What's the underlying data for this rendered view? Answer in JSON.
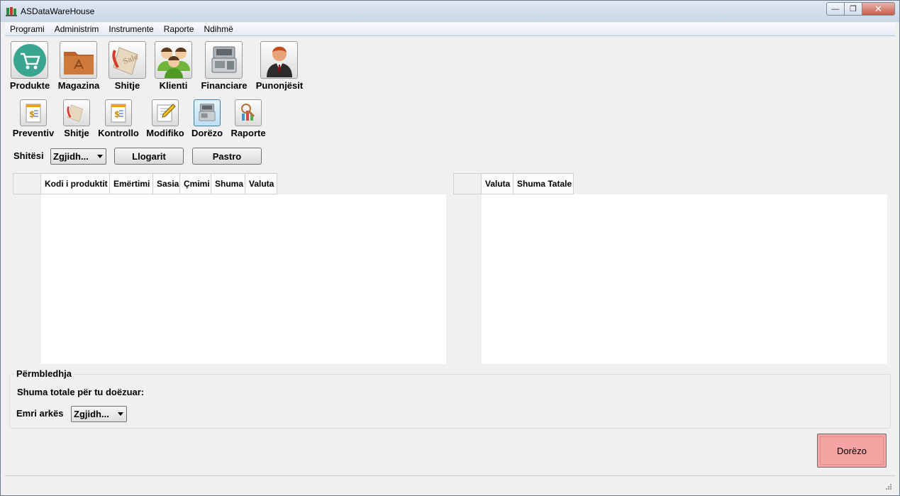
{
  "window": {
    "title": "ASDataWareHouse",
    "minimize": "—",
    "maximize": "❐",
    "close": "✕"
  },
  "menu": [
    "Programi",
    "Administrim",
    "Instrumente",
    "Raporte",
    "Ndihmë"
  ],
  "toolbar_large": [
    {
      "label": "Produkte",
      "icon": "shopping-cart-icon"
    },
    {
      "label": "Magazina",
      "icon": "warehouse-folder-icon"
    },
    {
      "label": "Shitje",
      "icon": "sale-tag-icon"
    },
    {
      "label": "Klienti",
      "icon": "clients-group-icon"
    },
    {
      "label": "Financiare",
      "icon": "cash-register-icon"
    },
    {
      "label": "Punonjësit",
      "icon": "employee-icon"
    }
  ],
  "toolbar_small": [
    {
      "label": "Preventiv",
      "icon": "document-money-icon"
    },
    {
      "label": "Shitje",
      "icon": "sale-tag-icon"
    },
    {
      "label": "Kontrollo",
      "icon": "document-money-icon"
    },
    {
      "label": "Modifiko",
      "icon": "edit-pencil-icon"
    },
    {
      "label": "Dorëzo",
      "icon": "cash-register-icon",
      "active": true
    },
    {
      "label": "Raporte",
      "icon": "report-magnifier-icon"
    }
  ],
  "filter": {
    "seller_label": "Shitësi",
    "seller_value": "Zgjidh...",
    "calculate": "Llogarit",
    "clear": "Pastro"
  },
  "products_table": {
    "columns": [
      "Kodi i produktit",
      "Emërtimi",
      "Sasia",
      "Çmimi",
      "Shuma",
      "Valuta"
    ],
    "rows": []
  },
  "totals_table": {
    "columns": [
      "Valuta",
      "Shuma Tatale"
    ],
    "rows": []
  },
  "summary": {
    "title": "Përmbledhja",
    "total_label": "Shuma totale për tu doëzuar:",
    "register_label": "Emri arkës",
    "register_value": "Zgjidh..."
  },
  "deliver_button": "Dorëzo",
  "colors": {
    "deliver_button": "#f5a3a3",
    "title_bar": "#c9d7e6"
  }
}
